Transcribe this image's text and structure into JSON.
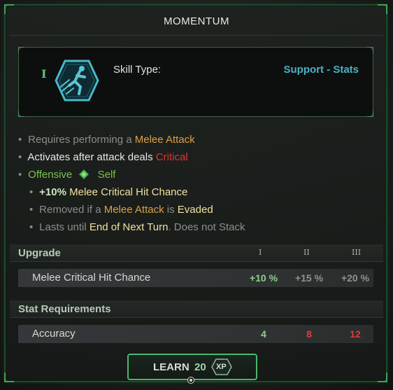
{
  "title": "MOMENTUM",
  "skill": {
    "tier": "I",
    "icon": "momentum-skill-icon",
    "type_label": "Skill Type:",
    "type_value": "Support - Stats"
  },
  "description": {
    "line1": {
      "a": "Requires performing a",
      "b": "Melee Attack"
    },
    "line2": {
      "a": "Activates after attack deals",
      "b": "Critical"
    },
    "line3": {
      "a": "Offensive",
      "b": "Self"
    },
    "line4": {
      "a": "+10%",
      "b": "Melee Critical Hit Chance"
    },
    "line5": {
      "a": "Removed if a",
      "b": "Melee Attack",
      "c": "is",
      "d": "Evaded"
    },
    "line6": {
      "a": "Lasts until",
      "b": "End of Next Turn",
      "c": ". Does not Stack"
    }
  },
  "upgrade": {
    "header": "Upgrade",
    "tiers": [
      "I",
      "II",
      "III"
    ],
    "row": {
      "name": "Melee Critical Hit Chance",
      "values": [
        "+10 %",
        "+15 %",
        "+20 %"
      ]
    }
  },
  "requirements": {
    "header": "Stat Requirements",
    "row": {
      "name": "Accuracy",
      "values": [
        "4",
        "8",
        "12"
      ]
    }
  },
  "learn": {
    "label": "LEARN",
    "cost": "20",
    "currency": "XP"
  },
  "colors": {
    "accent_green": "#49b86a",
    "skill_type_cyan": "#49b3c2",
    "warn_red": "#d93838",
    "highlight_orange": "#d9a048"
  }
}
